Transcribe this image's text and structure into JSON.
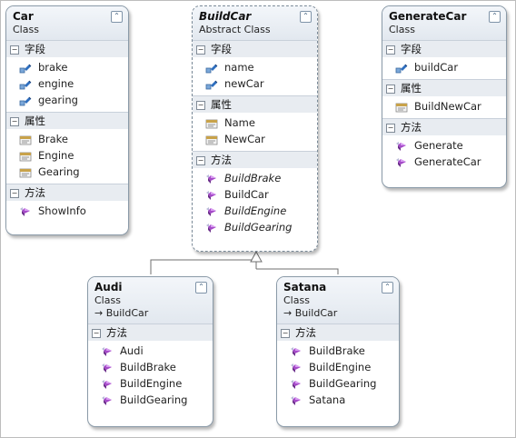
{
  "classes": {
    "car": {
      "name": "Car",
      "kind": "Class",
      "sections": [
        {
          "title": "字段",
          "members": [
            "brake",
            "engine",
            "gearing"
          ],
          "icon": "field-icon"
        },
        {
          "title": "属性",
          "members": [
            "Brake",
            "Engine",
            "Gearing"
          ],
          "icon": "property-icon"
        },
        {
          "title": "方法",
          "members": [
            "ShowInfo"
          ],
          "icon": "method-icon"
        }
      ]
    },
    "buildcar": {
      "name": "BuildCar",
      "kind": "Abstract Class",
      "sections": [
        {
          "title": "字段",
          "members": [
            "name",
            "newCar"
          ],
          "icon": "field-icon"
        },
        {
          "title": "属性",
          "members": [
            "Name",
            "NewCar"
          ],
          "icon": "property-icon"
        },
        {
          "title": "方法",
          "members": [
            "BuildBrake",
            "BuildCar",
            "BuildEngine",
            "BuildGearing"
          ],
          "icon": "method-icon",
          "italic": [
            true,
            false,
            true,
            true
          ]
        }
      ]
    },
    "generatecar": {
      "name": "GenerateCar",
      "kind": "Class",
      "sections": [
        {
          "title": "字段",
          "members": [
            "buildCar"
          ],
          "icon": "field-icon"
        },
        {
          "title": "属性",
          "members": [
            "BuildNewCar"
          ],
          "icon": "property-icon"
        },
        {
          "title": "方法",
          "members": [
            "Generate",
            "GenerateCar"
          ],
          "icon": "method-icon"
        }
      ]
    },
    "audi": {
      "name": "Audi",
      "kind": "Class",
      "parent": "BuildCar",
      "sections": [
        {
          "title": "方法",
          "members": [
            "Audi",
            "BuildBrake",
            "BuildEngine",
            "BuildGearing"
          ],
          "icon": "method-icon"
        }
      ]
    },
    "satana": {
      "name": "Satana",
      "kind": "Class",
      "parent": "BuildCar",
      "sections": [
        {
          "title": "方法",
          "members": [
            "BuildBrake",
            "BuildEngine",
            "BuildGearing",
            "Satana"
          ],
          "icon": "method-icon"
        }
      ]
    }
  },
  "ui": {
    "collapse_glyph": "⌃",
    "section_glyph": "−",
    "inherit_glyph": "→"
  },
  "colors": {
    "method": "#a64ac9",
    "field": "#2f6fbf",
    "property": "#c8a24a",
    "border": "#8a9aa8"
  }
}
